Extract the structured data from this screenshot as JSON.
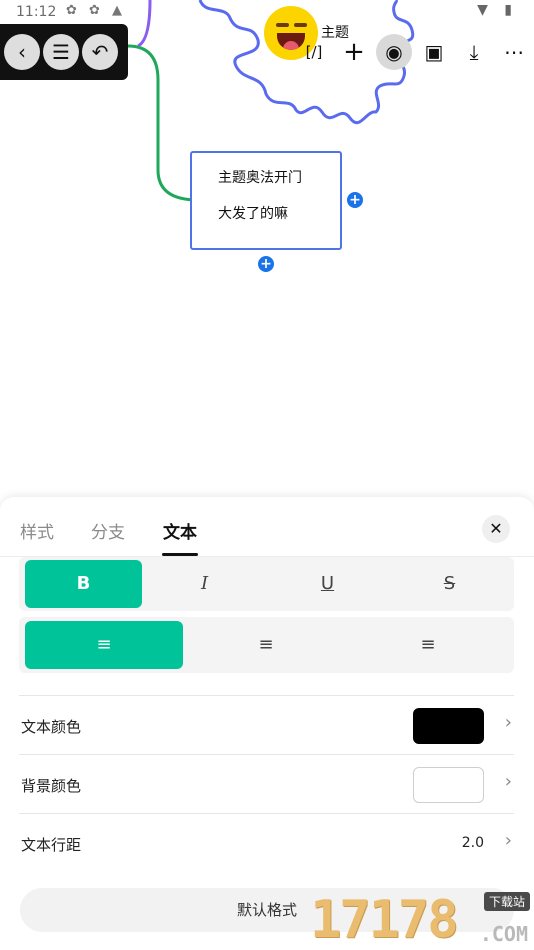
{
  "status_bar": {
    "time": "11:12",
    "icons": [
      "notification-icon",
      "notification-icon",
      "a-icon"
    ],
    "right_icons": [
      "wifi-icon",
      "battery-icon"
    ]
  },
  "left_toolbar": {
    "buttons": [
      {
        "icon": "chevron-left-icon",
        "glyph": "‹"
      },
      {
        "icon": "outline-list-icon",
        "glyph": "☰"
      },
      {
        "icon": "undo-icon",
        "glyph": "↶"
      }
    ]
  },
  "center_node": {
    "label": "主题",
    "emoji": "grinning-face"
  },
  "top_actions": [
    {
      "icon": "formula-icon",
      "glyph": "[/]"
    },
    {
      "icon": "add-icon",
      "glyph": "+"
    },
    {
      "icon": "palette-icon",
      "glyph": "◉",
      "active": true
    },
    {
      "icon": "save-icon",
      "glyph": "▣"
    },
    {
      "icon": "download-icon",
      "glyph": "⤓"
    },
    {
      "icon": "more-icon",
      "glyph": "⋯"
    }
  ],
  "topic_node": {
    "line1": "主题奥法开门",
    "line2": "大发了的嘛"
  },
  "sheet": {
    "tabs": [
      "样式",
      "分支",
      "文本"
    ],
    "active_tab": "文本",
    "close_glyph": "✕",
    "style_buttons": [
      {
        "label": "B",
        "icon": "bold-icon",
        "on": true
      },
      {
        "label": "I",
        "icon": "italic-icon",
        "on": false
      },
      {
        "label": "U",
        "icon": "underline-icon",
        "on": false
      },
      {
        "label": "S",
        "icon": "strikethrough-icon",
        "on": false
      }
    ],
    "align_buttons": [
      {
        "label": "≡",
        "icon": "align-left-icon",
        "on": true
      },
      {
        "label": "≡",
        "icon": "align-center-icon",
        "on": false
      },
      {
        "label": "≡",
        "icon": "align-right-icon",
        "on": false
      }
    ],
    "rows": {
      "text_color": {
        "label": "文本颜色",
        "color": "#000000"
      },
      "bg_color": {
        "label": "背景颜色",
        "color": "#ffffff"
      },
      "line_spacing": {
        "label": "文本行距",
        "value": "2.0"
      }
    },
    "chevron": "›",
    "default_button": "默认格式"
  },
  "watermark": {
    "digits": "17178",
    "tag": "下载站",
    "domain": ".COM"
  },
  "colors": {
    "accent": "#00c39a",
    "node_border": "#4e74e8",
    "branch": "#1fa85a",
    "blob": "#5a6bf0",
    "plus": "#1a73e8"
  }
}
